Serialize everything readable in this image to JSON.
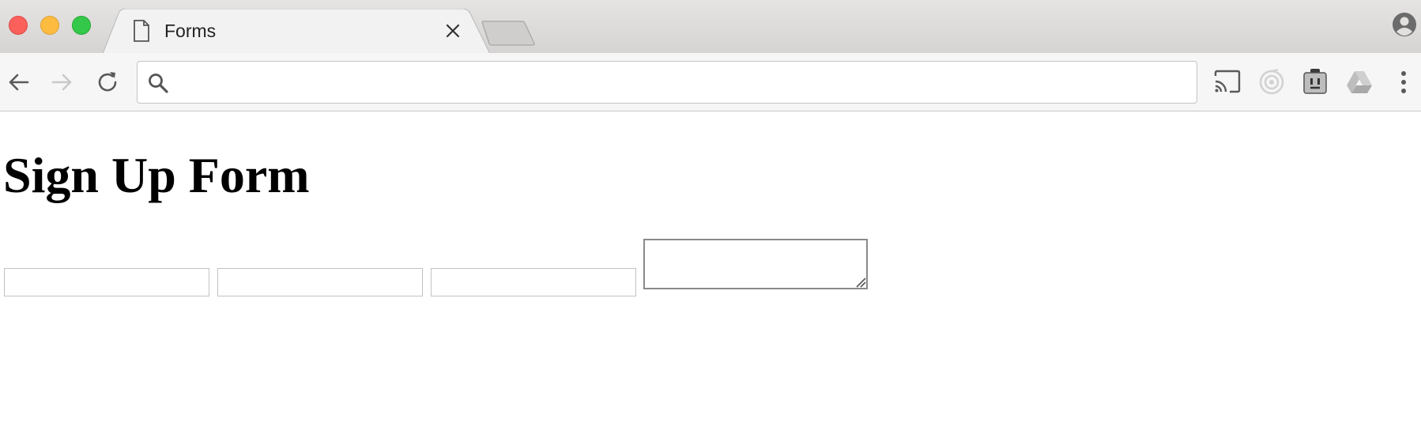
{
  "browser": {
    "tab": {
      "title": "Forms",
      "page_icon": "document-icon",
      "close_icon": "close-icon"
    },
    "new_tab_icon": "new-tab-icon",
    "profile_icon": "profile-icon",
    "traffic_lights": {
      "close": "#fc605b",
      "minimize": "#fdbc40",
      "zoom": "#34c84a"
    }
  },
  "toolbar": {
    "back_icon": "back-arrow-icon",
    "forward_icon": "forward-arrow-icon",
    "reload_icon": "reload-icon",
    "omnibox": {
      "value": "",
      "placeholder": "",
      "icon": "search-icon"
    },
    "extensions": [
      "cast-icon",
      "extension-target-icon",
      "extension-plug-icon",
      "google-drive-icon"
    ],
    "menu_icon": "more-vertical-icon"
  },
  "page": {
    "heading": "Sign Up Form",
    "fields": [
      {
        "value": ""
      },
      {
        "value": ""
      },
      {
        "value": ""
      }
    ],
    "textarea": {
      "value": ""
    }
  }
}
